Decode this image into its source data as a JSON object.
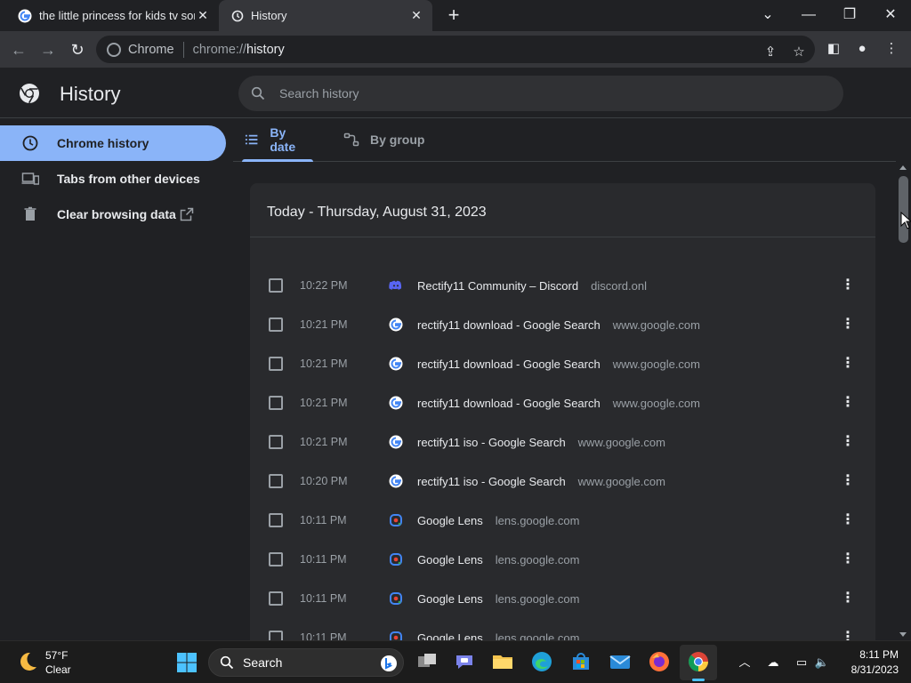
{
  "tabs": [
    {
      "title": "the little princess for kids tv song",
      "icon": "google-g-icon",
      "active": false
    },
    {
      "title": "History",
      "icon": "history-icon",
      "active": true
    }
  ],
  "toolbar": {
    "omnibox_site": "Chrome",
    "url_scheme": "chrome://",
    "url_path": "history"
  },
  "header": {
    "title": "History",
    "search_placeholder": "Search history"
  },
  "sidebar": {
    "items": [
      {
        "label": "Chrome history",
        "icon": "clock-icon",
        "active": true
      },
      {
        "label": "Tabs from other devices",
        "icon": "devices-icon",
        "active": false
      },
      {
        "label": "Clear browsing data",
        "icon": "trash-icon",
        "active": false
      }
    ]
  },
  "view_tabs": {
    "by_date": "By date",
    "by_group": "By group"
  },
  "day_header": "Today - Thursday, August 31, 2023",
  "entries": [
    {
      "time": "10:22 PM",
      "title": "Rectify11 Community – Discord",
      "domain": "discord.onl",
      "favicon": "discord-icon"
    },
    {
      "time": "10:21 PM",
      "title": "rectify11 download - Google Search",
      "domain": "www.google.com",
      "favicon": "google-g-icon"
    },
    {
      "time": "10:21 PM",
      "title": "rectify11 download - Google Search",
      "domain": "www.google.com",
      "favicon": "google-g-icon"
    },
    {
      "time": "10:21 PM",
      "title": "rectify11 download - Google Search",
      "domain": "www.google.com",
      "favicon": "google-g-icon"
    },
    {
      "time": "10:21 PM",
      "title": "rectify11 iso - Google Search",
      "domain": "www.google.com",
      "favicon": "google-g-icon"
    },
    {
      "time": "10:20 PM",
      "title": "rectify11 iso - Google Search",
      "domain": "www.google.com",
      "favicon": "google-g-icon"
    },
    {
      "time": "10:11 PM",
      "title": "Google Lens",
      "domain": "lens.google.com",
      "favicon": "google-lens-icon"
    },
    {
      "time": "10:11 PM",
      "title": "Google Lens",
      "domain": "lens.google.com",
      "favicon": "google-lens-icon"
    },
    {
      "time": "10:11 PM",
      "title": "Google Lens",
      "domain": "lens.google.com",
      "favicon": "google-lens-icon"
    },
    {
      "time": "10:11 PM",
      "title": "Google Lens",
      "domain": "lens.google.com",
      "favicon": "google-lens-icon"
    }
  ],
  "taskbar": {
    "weather_temp": "57°F",
    "weather_condition": "Clear",
    "search_label": "Search",
    "clock_time": "8:11 PM",
    "clock_date": "8/31/2023"
  },
  "colors": {
    "accent": "#8ab4f8",
    "background": "#202124",
    "card": "#292a2d",
    "toolbar": "#35363a"
  }
}
